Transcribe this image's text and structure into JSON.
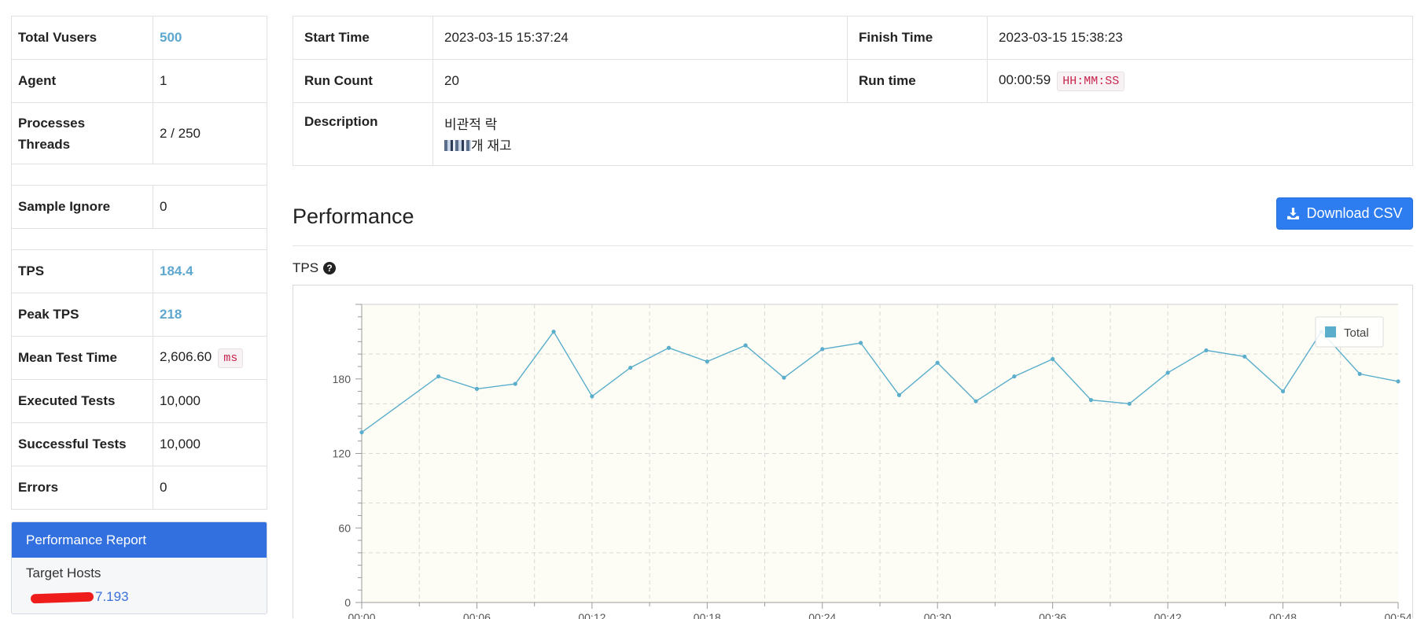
{
  "summary": {
    "total_vusers": {
      "label": "Total Vusers",
      "value": "500"
    },
    "agent": {
      "label": "Agent",
      "value": "1"
    },
    "processes_threads": {
      "label": "Processes Threads",
      "value": "2 / 250"
    },
    "sample_ignore": {
      "label": "Sample Ignore",
      "value": "0"
    },
    "tps": {
      "label": "TPS",
      "value": "184.4"
    },
    "peak_tps": {
      "label": "Peak TPS",
      "value": "218"
    },
    "mean_test_time": {
      "label": "Mean Test Time",
      "value": "2,606.60",
      "unit": "ms"
    },
    "executed_tests": {
      "label": "Executed Tests",
      "value": "10,000"
    },
    "successful_tests": {
      "label": "Successful Tests",
      "value": "10,000"
    },
    "errors": {
      "label": "Errors",
      "value": "0"
    }
  },
  "report": {
    "title": "Performance Report",
    "target_hosts_label": "Target Hosts",
    "host_visible": "7.193"
  },
  "info": {
    "start_time": {
      "label": "Start Time",
      "value": "2023-03-15 15:37:24"
    },
    "finish_time": {
      "label": "Finish Time",
      "value": "2023-03-15 15:38:23"
    },
    "run_count": {
      "label": "Run Count",
      "value": "20"
    },
    "run_time": {
      "label": "Run time",
      "value": "00:00:59",
      "unit": "HH:MM:SS"
    },
    "description": {
      "label": "Description",
      "line1": "비관적 락",
      "line2": "개 재고"
    }
  },
  "performance": {
    "title": "Performance",
    "download_label": "Download CSV",
    "tps_label": "TPS"
  },
  "colors": {
    "accent": "#3370df",
    "button": "#2d7cf0",
    "highlight": "#5ea7cf",
    "line": "#5aaecb",
    "plot_bg": "#fefdf5"
  },
  "icons": {
    "download": "download-icon",
    "help": "question-circle-icon",
    "legend": "legend-swatch-icon"
  },
  "chart_data": {
    "type": "line",
    "x_tick_labels": [
      "00:00",
      "00:06",
      "00:12",
      "00:18",
      "00:24",
      "00:30",
      "00:36",
      "00:42",
      "00:48",
      "00:54"
    ],
    "y_tick_labels": [
      "0",
      "60",
      "120",
      "180"
    ],
    "ylim": [
      0,
      240
    ],
    "grid": true,
    "legend_position": "top-right",
    "series": [
      {
        "name": "Total",
        "x": [
          0,
          4,
          6,
          8,
          10,
          12,
          14,
          16,
          18,
          20,
          22,
          24,
          26,
          28,
          30,
          32,
          34,
          36,
          38,
          40,
          42,
          44,
          46,
          48,
          50,
          52,
          54
        ],
        "values": [
          137,
          182,
          172,
          176,
          218,
          166,
          189,
          205,
          194,
          207,
          181,
          204,
          209,
          167,
          193,
          162,
          182,
          196,
          163,
          160,
          185,
          203,
          198,
          170,
          218,
          184,
          178
        ]
      }
    ]
  }
}
